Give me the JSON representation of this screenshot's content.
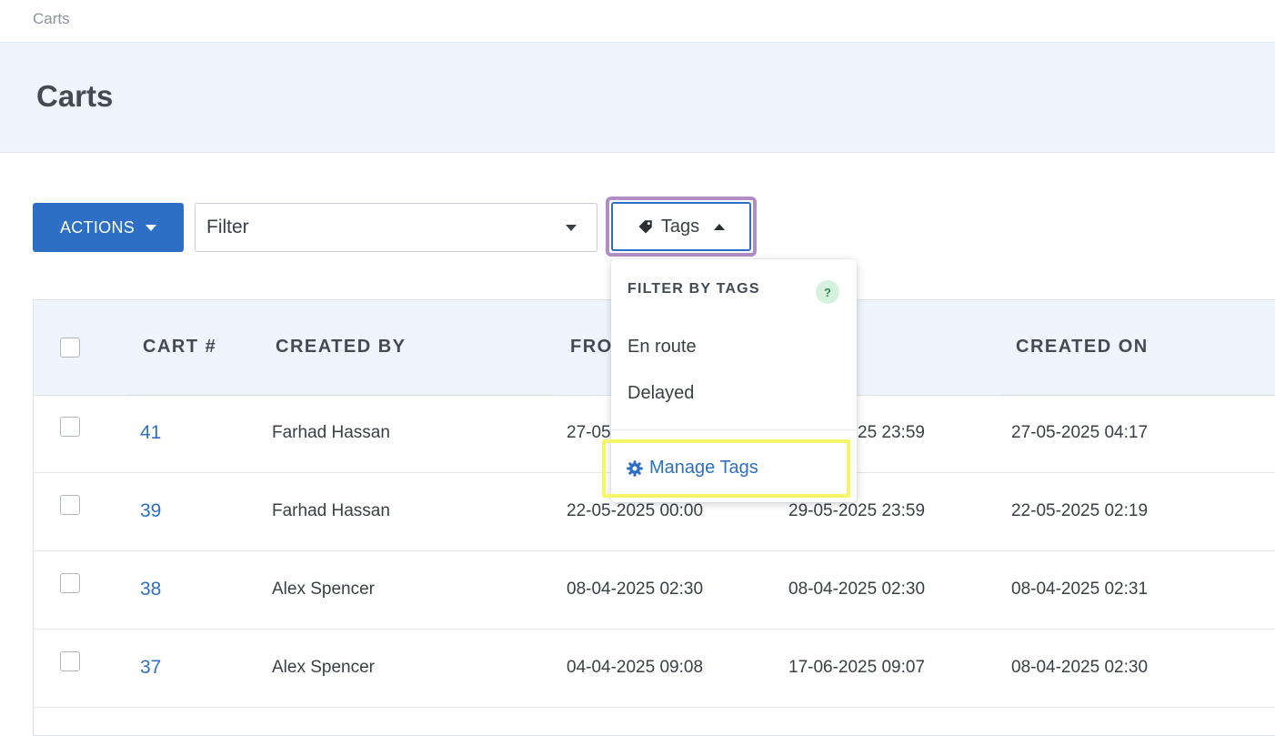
{
  "breadcrumb": "Carts",
  "page_title": "Carts",
  "toolbar": {
    "actions_label": "ACTIONS",
    "filter_label": "Filter",
    "tags_label": "Tags"
  },
  "table": {
    "headers": [
      "CART #",
      "CREATED BY",
      "FRO",
      "CREATED ON"
    ],
    "rows": [
      {
        "cart": "41",
        "created_by": "Farhad Hassan",
        "from": "27-05",
        "to": "25 23:59",
        "created_on": "27-05-2025 04:17"
      },
      {
        "cart": "39",
        "created_by": "Farhad Hassan",
        "from": "22-05-2025 00:00",
        "to": "29-05-2025 23:59",
        "created_on": "22-05-2025 02:19"
      },
      {
        "cart": "38",
        "created_by": "Alex Spencer",
        "from": "08-04-2025 02:30",
        "to": "08-04-2025 02:30",
        "created_on": "08-04-2025 02:31"
      },
      {
        "cart": "37",
        "created_by": "Alex Spencer",
        "from": "04-04-2025 09:08",
        "to": "17-06-2025 09:07",
        "created_on": "08-04-2025 02:30"
      }
    ]
  },
  "tags_dropdown": {
    "title": "FILTER BY TAGS",
    "help": "?",
    "items": [
      "En route",
      "Delayed"
    ],
    "manage_label": "Manage Tags"
  },
  "colors": {
    "primary": "#2e6fc6",
    "header_bg": "#eef5fd",
    "focus_outline": "#b08ec2",
    "highlight": "#f5f56a"
  }
}
